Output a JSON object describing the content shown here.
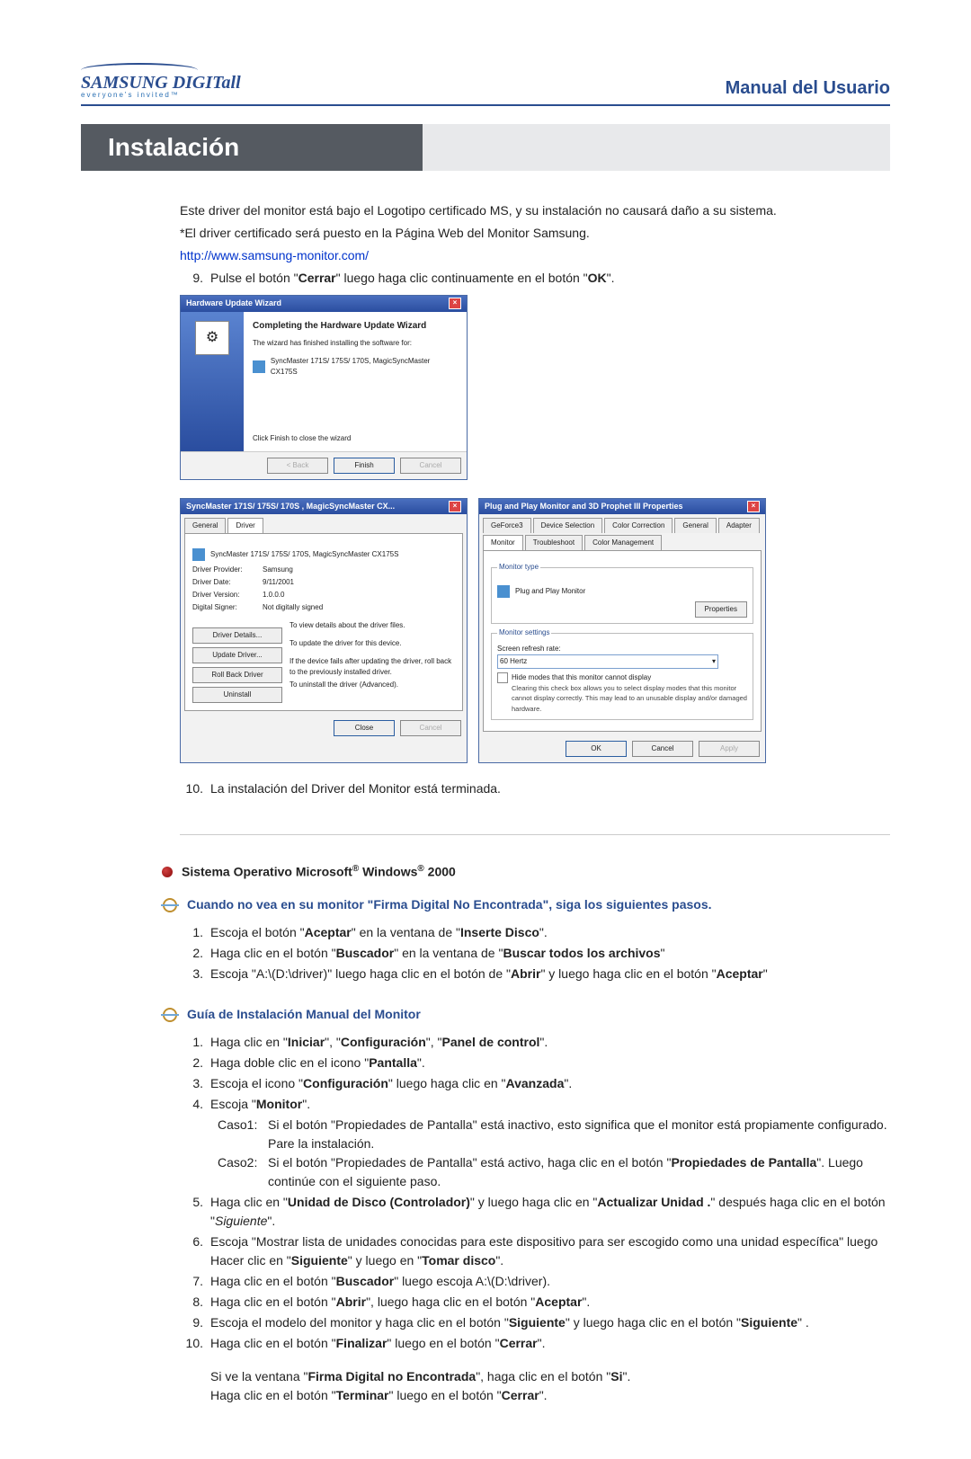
{
  "header": {
    "logo_main": "SAMSUNG DIGITall",
    "logo_sub": "everyone's invited™",
    "manual_title": "Manual del Usuario"
  },
  "section_banner": "Instalación",
  "intro": {
    "p1": "Este driver del monitor está bajo el Logotipo certificado MS, y su instalación no causará daño a su sistema.",
    "p2": "*El driver certificado será puesto en la Página Web del Monitor Samsung.",
    "link": "http://www.samsung-monitor.com/",
    "step9_num": "9.",
    "step9": "Pulse el botón \"Cerrar\" luego haga clic continuamente en el botón \"OK\"."
  },
  "wizard_win": {
    "titlebar": "Hardware Update Wizard",
    "wtitle": "Completing the Hardware Update Wizard",
    "line1": "The wizard has finished installing the software for:",
    "device": "SyncMaster 171S/ 175S/ 170S, MagicSyncMaster CX175S",
    "click_finish": "Click Finish to close the wizard",
    "back": "< Back",
    "finish": "Finish",
    "cancel": "Cancel"
  },
  "prop_left": {
    "titlebar": "SyncMaster 171S/ 175S/ 170S , MagicSyncMaster CX...",
    "tab_general": "General",
    "tab_driver": "Driver",
    "device": "SyncMaster 171S/ 175S/ 170S, MagicSyncMaster CX175S",
    "rows": {
      "provider_k": "Driver Provider:",
      "provider_v": "Samsung",
      "date_k": "Driver Date:",
      "date_v": "9/11/2001",
      "version_k": "Driver Version:",
      "version_v": "1.0.0.0",
      "signer_k": "Digital Signer:",
      "signer_v": "Not digitally signed"
    },
    "btns": {
      "details": "Driver Details...",
      "details_d": "To view details about the driver files.",
      "update": "Update Driver...",
      "update_d": "To update the driver for this device.",
      "rollback": "Roll Back Driver",
      "rollback_d": "If the device fails after updating the driver, roll back to the previously installed driver.",
      "uninstall": "Uninstall",
      "uninstall_d": "To uninstall the driver (Advanced)."
    },
    "close": "Close",
    "cancel": "Cancel"
  },
  "prop_right": {
    "titlebar": "Plug and Play Monitor and 3D Prophet III Properties",
    "tabs": [
      "GeForce3",
      "Device Selection",
      "Color Correction",
      "General",
      "Adapter",
      "Monitor",
      "Troubleshoot",
      "Color Management"
    ],
    "monitor_type_legend": "Monitor type",
    "monitor_type_val": "Plug and Play Monitor",
    "properties_btn": "Properties",
    "settings_legend": "Monitor settings",
    "refresh_label": "Screen refresh rate:",
    "refresh_val": "60 Hertz",
    "hide_checkbox": "Hide modes that this monitor cannot display",
    "hide_note": "Clearing this check box allows you to select display modes that this monitor cannot display correctly. This may lead to an unusable display and/or damaged hardware.",
    "ok": "OK",
    "cancel": "Cancel",
    "apply": "Apply"
  },
  "step10_num": "10.",
  "step10": "La instalación del Driver del Monitor está terminada.",
  "win2000_heading": "Sistema Operativo Microsoft® Windows® 2000",
  "blue_heading_1": "Cuando no vea en su monitor \"Firma Digital No Encontrada\", siga los siguientes pasos.",
  "list_a": {
    "n1": "1.",
    "t1_pre": "Escoja el botón \"",
    "t1_b1": "Aceptar",
    "t1_mid": "\" en la ventana de \"",
    "t1_b2": "Inserte Disco",
    "t1_post": "\".",
    "n2": "2.",
    "t2_pre": "Haga clic en el botón \"",
    "t2_b1": "Buscador",
    "t2_mid": "\" en la ventana de \"",
    "t2_b2": "Buscar todos los archivos",
    "t2_post": "\"",
    "n3": "3.",
    "t3_pre": "Escoja \"A:\\(D:\\driver)\" luego haga clic en el botón de \"",
    "t3_b1": "Abrir",
    "t3_mid": "\" y luego haga clic en el botón \"",
    "t3_b2": "Aceptar",
    "t3_post": "\""
  },
  "blue_heading_2": "Guía de Instalación Manual del Monitor",
  "list_b": {
    "n1": "1.",
    "t1": "Haga clic en \"",
    "t1b1": "Iniciar",
    "t1m1": "\", \"",
    "t1b2": "Configuración",
    "t1m2": "\", \"",
    "t1b3": "Panel de control",
    "t1end": "\".",
    "n2": "2.",
    "t2": "Haga doble clic en el icono \"",
    "t2b": "Pantalla",
    "t2end": "\".",
    "n3": "3.",
    "t3": "Escoja el icono \"",
    "t3b1": "Configuración",
    "t3m": "\" luego haga clic en \"",
    "t3b2": "Avanzada",
    "t3end": "\".",
    "n4": "4.",
    "t4": "Escoja \"",
    "t4b": "Monitor",
    "t4end": "\".",
    "c1l": "Caso1:",
    "c1": "Si el botón \"Propiedades de Pantalla\" está inactivo, esto significa que el monitor está propiamente configurado. Pare la instalación.",
    "c2l": "Caso2:",
    "c2pre": "Si el botón \"Propiedades de Pantalla\" está activo, haga clic en el botón \"",
    "c2b": "Propiedades de Pantalla",
    "c2post": "\". Luego continúe con el siguiente paso.",
    "n5": "5.",
    "t5pre": "Haga clic en \"",
    "t5b1": "Unidad de Disco (Controlador)",
    "t5m1": "\" y luego haga clic en \"",
    "t5b2": "Actualizar Unidad .",
    "t5m2": "\" después haga clic en el botón \"",
    "t5i": "Siguiente",
    "t5end": "\".",
    "n6": "6.",
    "t6pre": "Escoja \"Mostrar lista de unidades conocidas para este dispositivo para ser escogido como una unidad específica\" luego Hacer clic en \"",
    "t6b1": "Siguiente",
    "t6m": "\" y luego en \"",
    "t6b2": "Tomar disco",
    "t6end": "\".",
    "n7": "7.",
    "t7pre": "Haga clic en el botón \"",
    "t7b": "Buscador",
    "t7post": "\" luego escoja A:\\(D:\\driver).",
    "n8": "8.",
    "t8pre": "Haga clic en el botón \"",
    "t8b1": "Abrir",
    "t8m": "\", luego haga clic en el botón \"",
    "t8b2": "Aceptar",
    "t8end": "\".",
    "n9": "9.",
    "t9pre": "Escoja el modelo del monitor y haga clic en el botón \"",
    "t9b1": "Siguiente",
    "t9m": "\" y luego haga clic en el botón \"",
    "t9b2": "Siguiente",
    "t9end": "\" .",
    "n10": "10.",
    "t10pre": "Haga clic en el botón \"",
    "t10b1": "Finalizar",
    "t10m": "\" luego en el botón \"",
    "t10b2": "Cerrar",
    "t10end": "\".",
    "f1pre": "Si ve la ventana \"",
    "f1b": "Firma Digital no Encontrada",
    "f1m": "\", haga clic en el botón \"",
    "f1b2": "Si",
    "f1end": "\".",
    "f2pre": "Haga clic en el botón \"",
    "f2b1": "Terminar",
    "f2m": "\" luego en el botón \"",
    "f2b2": "Cerrar",
    "f2end": "\"."
  }
}
